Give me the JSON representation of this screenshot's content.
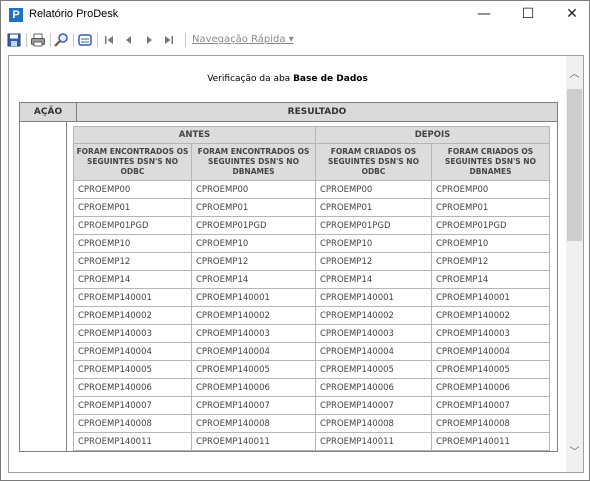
{
  "window": {
    "title": "Relatório ProDesk",
    "app_icon_letter": "P",
    "minimize": "—",
    "maximize": "☐",
    "close": "✕"
  },
  "toolbar": {
    "icons": [
      "save-icon",
      "print-icon",
      "find-icon",
      "print-setup-icon",
      "first-page-icon",
      "previous-page-icon",
      "next-page-icon",
      "last-page-icon"
    ],
    "nav_label": "Navegação Rápida ▾"
  },
  "report": {
    "heading_prefix": "Verificação da aba ",
    "heading_bold": "Base de Dados",
    "col_acao": "AÇÃO",
    "col_resultado": "RESULTADO",
    "group_antes": "ANTES",
    "group_depois": "DEPOIS",
    "sub_headers": [
      "FORAM ENCONTRADOS OS SEGUINTES DSN'S NO ODBC",
      "FORAM ENCONTRADOS OS SEGUINTES DSN'S NO DBNAMES",
      "FORAM CRIADOS OS SEGUINTES DSN'S NO ODBC",
      "FORAM CRIADOS OS SEGUINTES DSN'S NO DBNAMES"
    ],
    "rows": [
      [
        "CPROEMP00",
        "CPROEMP00",
        "CPROEMP00",
        "CPROEMP00"
      ],
      [
        "CPROEMP01",
        "CPROEMP01",
        "CPROEMP01",
        "CPROEMP01"
      ],
      [
        "CPROEMP01PGD",
        "CPROEMP01PGD",
        "CPROEMP01PGD",
        "CPROEMP01PGD"
      ],
      [
        "CPROEMP10",
        "CPROEMP10",
        "CPROEMP10",
        "CPROEMP10"
      ],
      [
        "CPROEMP12",
        "CPROEMP12",
        "CPROEMP12",
        "CPROEMP12"
      ],
      [
        "CPROEMP14",
        "CPROEMP14",
        "CPROEMP14",
        "CPROEMP14"
      ],
      [
        "CPROEMP140001",
        "CPROEMP140001",
        "CPROEMP140001",
        "CPROEMP140001"
      ],
      [
        "CPROEMP140002",
        "CPROEMP140002",
        "CPROEMP140002",
        "CPROEMP140002"
      ],
      [
        "CPROEMP140003",
        "CPROEMP140003",
        "CPROEMP140003",
        "CPROEMP140003"
      ],
      [
        "CPROEMP140004",
        "CPROEMP140004",
        "CPROEMP140004",
        "CPROEMP140004"
      ],
      [
        "CPROEMP140005",
        "CPROEMP140005",
        "CPROEMP140005",
        "CPROEMP140005"
      ],
      [
        "CPROEMP140006",
        "CPROEMP140006",
        "CPROEMP140006",
        "CPROEMP140006"
      ],
      [
        "CPROEMP140007",
        "CPROEMP140007",
        "CPROEMP140007",
        "CPROEMP140007"
      ],
      [
        "CPROEMP140008",
        "CPROEMP140008",
        "CPROEMP140008",
        "CPROEMP140008"
      ],
      [
        "CPROEMP140011",
        "CPROEMP140011",
        "CPROEMP140011",
        "CPROEMP140011"
      ]
    ]
  },
  "colors": {
    "header_bg": "#d9d9d9",
    "accent": "#1e73be"
  }
}
